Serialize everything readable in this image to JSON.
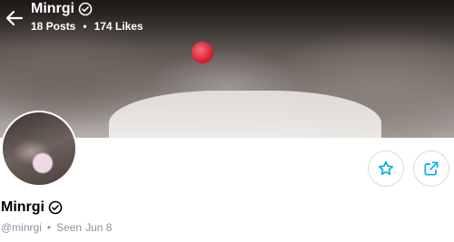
{
  "header": {
    "name": "Minrgi",
    "posts_label": "18 Posts",
    "likes_label": "174 Likes",
    "separator": "•"
  },
  "profile": {
    "name": "Minrgi",
    "username": "@minrgi",
    "separator": "•",
    "seen_label": "Seen",
    "seen_date": "Jun 8"
  },
  "icons": {
    "back": "arrow-left-icon",
    "verified": "verified-badge-icon",
    "favorite": "star-icon",
    "share": "share-icon"
  },
  "colors": {
    "accent": "#00aff0",
    "muted_text": "#8a96a3",
    "button_border": "#d9dbe0"
  }
}
